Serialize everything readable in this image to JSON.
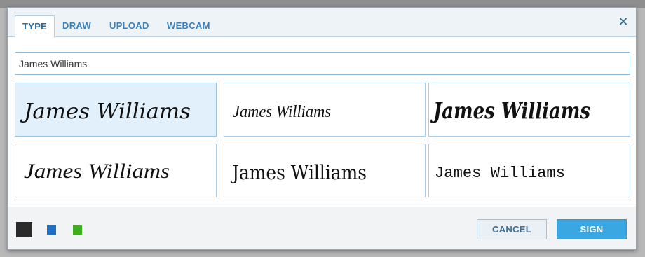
{
  "tabs": [
    {
      "label": "TYPE",
      "active": true
    },
    {
      "label": "DRAW",
      "active": false
    },
    {
      "label": "UPLOAD",
      "active": false
    },
    {
      "label": "WEBCAM",
      "active": false
    }
  ],
  "close_icon": "close-icon",
  "name_input": {
    "value": "James Williams"
  },
  "signature_options": [
    {
      "text": "James Williams",
      "style": "script-1",
      "selected": true
    },
    {
      "text": "James Williams",
      "style": "script-2",
      "selected": false
    },
    {
      "text": "James Williams",
      "style": "script-3-bold",
      "selected": false
    },
    {
      "text": "James Williams",
      "style": "script-4",
      "selected": false
    },
    {
      "text": "James Williams",
      "style": "script-5",
      "selected": false
    },
    {
      "text": "James Williams",
      "style": "script-6",
      "selected": false
    }
  ],
  "ink_colors": [
    {
      "name": "black",
      "hex": "#2b2b2b",
      "selected": true
    },
    {
      "name": "blue",
      "hex": "#1f6fc1",
      "selected": false
    },
    {
      "name": "green",
      "hex": "#3fae1e",
      "selected": false
    }
  ],
  "buttons": {
    "cancel": "CANCEL",
    "sign": "SIGN"
  }
}
